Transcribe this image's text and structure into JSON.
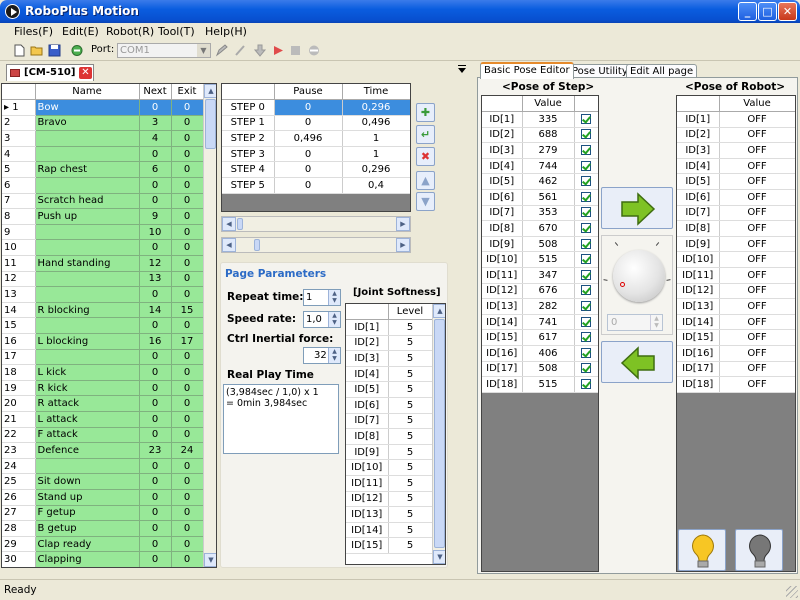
{
  "window": {
    "title": "RoboPlus Motion"
  },
  "menu": [
    "Files(F)",
    "Edit(E)",
    "Robot(R)",
    "Tool(T)",
    "Help(H)"
  ],
  "toolbar": {
    "port_label": "Port:",
    "port_value": "COM1"
  },
  "doc_tab": {
    "label": "[CM-510]"
  },
  "motion_list": {
    "columns": [
      "Name",
      "Next",
      "Exit"
    ],
    "rows": [
      {
        "n": "1",
        "name": "Bow",
        "next": "0",
        "exit": "0"
      },
      {
        "n": "2",
        "name": "Bravo",
        "next": "3",
        "exit": "0"
      },
      {
        "n": "3",
        "name": "",
        "next": "4",
        "exit": "0"
      },
      {
        "n": "4",
        "name": "",
        "next": "0",
        "exit": "0"
      },
      {
        "n": "5",
        "name": "Rap chest",
        "next": "6",
        "exit": "0"
      },
      {
        "n": "6",
        "name": "",
        "next": "0",
        "exit": "0"
      },
      {
        "n": "7",
        "name": "Scratch head",
        "next": "0",
        "exit": "0"
      },
      {
        "n": "8",
        "name": "Push up",
        "next": "9",
        "exit": "0"
      },
      {
        "n": "9",
        "name": "",
        "next": "10",
        "exit": "0"
      },
      {
        "n": "10",
        "name": "",
        "next": "0",
        "exit": "0"
      },
      {
        "n": "11",
        "name": "Hand standing",
        "next": "12",
        "exit": "0"
      },
      {
        "n": "12",
        "name": "",
        "next": "13",
        "exit": "0"
      },
      {
        "n": "13",
        "name": "",
        "next": "0",
        "exit": "0"
      },
      {
        "n": "14",
        "name": "R blocking",
        "next": "14",
        "exit": "15"
      },
      {
        "n": "15",
        "name": "",
        "next": "0",
        "exit": "0"
      },
      {
        "n": "16",
        "name": "L blocking",
        "next": "16",
        "exit": "17"
      },
      {
        "n": "17",
        "name": "",
        "next": "0",
        "exit": "0"
      },
      {
        "n": "18",
        "name": "L kick",
        "next": "0",
        "exit": "0"
      },
      {
        "n": "19",
        "name": "R kick",
        "next": "0",
        "exit": "0"
      },
      {
        "n": "20",
        "name": "R attack",
        "next": "0",
        "exit": "0"
      },
      {
        "n": "21",
        "name": "L attack",
        "next": "0",
        "exit": "0"
      },
      {
        "n": "22",
        "name": "F attack",
        "next": "0",
        "exit": "0"
      },
      {
        "n": "23",
        "name": "Defence",
        "next": "23",
        "exit": "24"
      },
      {
        "n": "24",
        "name": "",
        "next": "0",
        "exit": "0"
      },
      {
        "n": "25",
        "name": "Sit down",
        "next": "0",
        "exit": "0"
      },
      {
        "n": "26",
        "name": "Stand up",
        "next": "0",
        "exit": "0"
      },
      {
        "n": "27",
        "name": "F getup",
        "next": "0",
        "exit": "0"
      },
      {
        "n": "28",
        "name": "B getup",
        "next": "0",
        "exit": "0"
      },
      {
        "n": "29",
        "name": "Clap ready",
        "next": "0",
        "exit": "0"
      },
      {
        "n": "30",
        "name": "Clapping",
        "next": "0",
        "exit": "0"
      }
    ]
  },
  "steps": {
    "columns": [
      "Pause",
      "Time"
    ],
    "rows": [
      {
        "name": "STEP 0",
        "pause": "0",
        "time": "0,296"
      },
      {
        "name": "STEP 1",
        "pause": "0",
        "time": "0,496"
      },
      {
        "name": "STEP 2",
        "pause": "0,496",
        "time": "1"
      },
      {
        "name": "STEP 3",
        "pause": "0",
        "time": "1"
      },
      {
        "name": "STEP 4",
        "pause": "0",
        "time": "0,296"
      },
      {
        "name": "STEP 5",
        "pause": "0",
        "time": "0,4"
      }
    ]
  },
  "page_params": {
    "title": "Page Parameters",
    "repeat_label": "Repeat time:",
    "repeat_value": "1",
    "speed_label": "Speed rate:",
    "speed_value": "1,0",
    "inertial_label": "Ctrl Inertial force:",
    "inertial_value": "32",
    "real_play_label": "Real Play Time",
    "real_play_value": "(3,984sec / 1,0) x 1\n= 0min 3,984sec"
  },
  "joint_softness": {
    "title": "[Joint Softness]",
    "column": "Level",
    "rows": [
      {
        "id": "ID[1]",
        "level": "5"
      },
      {
        "id": "ID[2]",
        "level": "5"
      },
      {
        "id": "ID[3]",
        "level": "5"
      },
      {
        "id": "ID[4]",
        "level": "5"
      },
      {
        "id": "ID[5]",
        "level": "5"
      },
      {
        "id": "ID[6]",
        "level": "5"
      },
      {
        "id": "ID[7]",
        "level": "5"
      },
      {
        "id": "ID[8]",
        "level": "5"
      },
      {
        "id": "ID[9]",
        "level": "5"
      },
      {
        "id": "ID[10]",
        "level": "5"
      },
      {
        "id": "ID[11]",
        "level": "5"
      },
      {
        "id": "ID[12]",
        "level": "5"
      },
      {
        "id": "ID[13]",
        "level": "5"
      },
      {
        "id": "ID[14]",
        "level": "5"
      },
      {
        "id": "ID[15]",
        "level": "5"
      }
    ]
  },
  "right_tabs": [
    "Basic Pose Editor",
    "Pose Utility",
    "Edit All page"
  ],
  "pose_of_step": {
    "title": "<Pose of Step>",
    "column": "Value",
    "rows": [
      {
        "id": "ID[1]",
        "value": "335"
      },
      {
        "id": "ID[2]",
        "value": "688"
      },
      {
        "id": "ID[3]",
        "value": "279"
      },
      {
        "id": "ID[4]",
        "value": "744"
      },
      {
        "id": "ID[5]",
        "value": "462"
      },
      {
        "id": "ID[6]",
        "value": "561"
      },
      {
        "id": "ID[7]",
        "value": "353"
      },
      {
        "id": "ID[8]",
        "value": "670"
      },
      {
        "id": "ID[9]",
        "value": "508"
      },
      {
        "id": "ID[10]",
        "value": "515"
      },
      {
        "id": "ID[11]",
        "value": "347"
      },
      {
        "id": "ID[12]",
        "value": "676"
      },
      {
        "id": "ID[13]",
        "value": "282"
      },
      {
        "id": "ID[14]",
        "value": "741"
      },
      {
        "id": "ID[15]",
        "value": "617"
      },
      {
        "id": "ID[16]",
        "value": "406"
      },
      {
        "id": "ID[17]",
        "value": "508"
      },
      {
        "id": "ID[18]",
        "value": "515"
      }
    ]
  },
  "pose_of_robot": {
    "title": "<Pose of Robot>",
    "column": "Value",
    "rows": [
      {
        "id": "ID[1]",
        "value": "OFF"
      },
      {
        "id": "ID[2]",
        "value": "OFF"
      },
      {
        "id": "ID[3]",
        "value": "OFF"
      },
      {
        "id": "ID[4]",
        "value": "OFF"
      },
      {
        "id": "ID[5]",
        "value": "OFF"
      },
      {
        "id": "ID[6]",
        "value": "OFF"
      },
      {
        "id": "ID[7]",
        "value": "OFF"
      },
      {
        "id": "ID[8]",
        "value": "OFF"
      },
      {
        "id": "ID[9]",
        "value": "OFF"
      },
      {
        "id": "ID[10]",
        "value": "OFF"
      },
      {
        "id": "ID[11]",
        "value": "OFF"
      },
      {
        "id": "ID[12]",
        "value": "OFF"
      },
      {
        "id": "ID[13]",
        "value": "OFF"
      },
      {
        "id": "ID[14]",
        "value": "OFF"
      },
      {
        "id": "ID[15]",
        "value": "OFF"
      },
      {
        "id": "ID[16]",
        "value": "OFF"
      },
      {
        "id": "ID[17]",
        "value": "OFF"
      },
      {
        "id": "ID[18]",
        "value": "OFF"
      }
    ]
  },
  "dial": {
    "value": "0"
  },
  "status": {
    "text": "Ready"
  },
  "colors": {
    "accent": "#3c8dde",
    "row_green": "#98e898",
    "title_blue": "#0a5ddf"
  }
}
